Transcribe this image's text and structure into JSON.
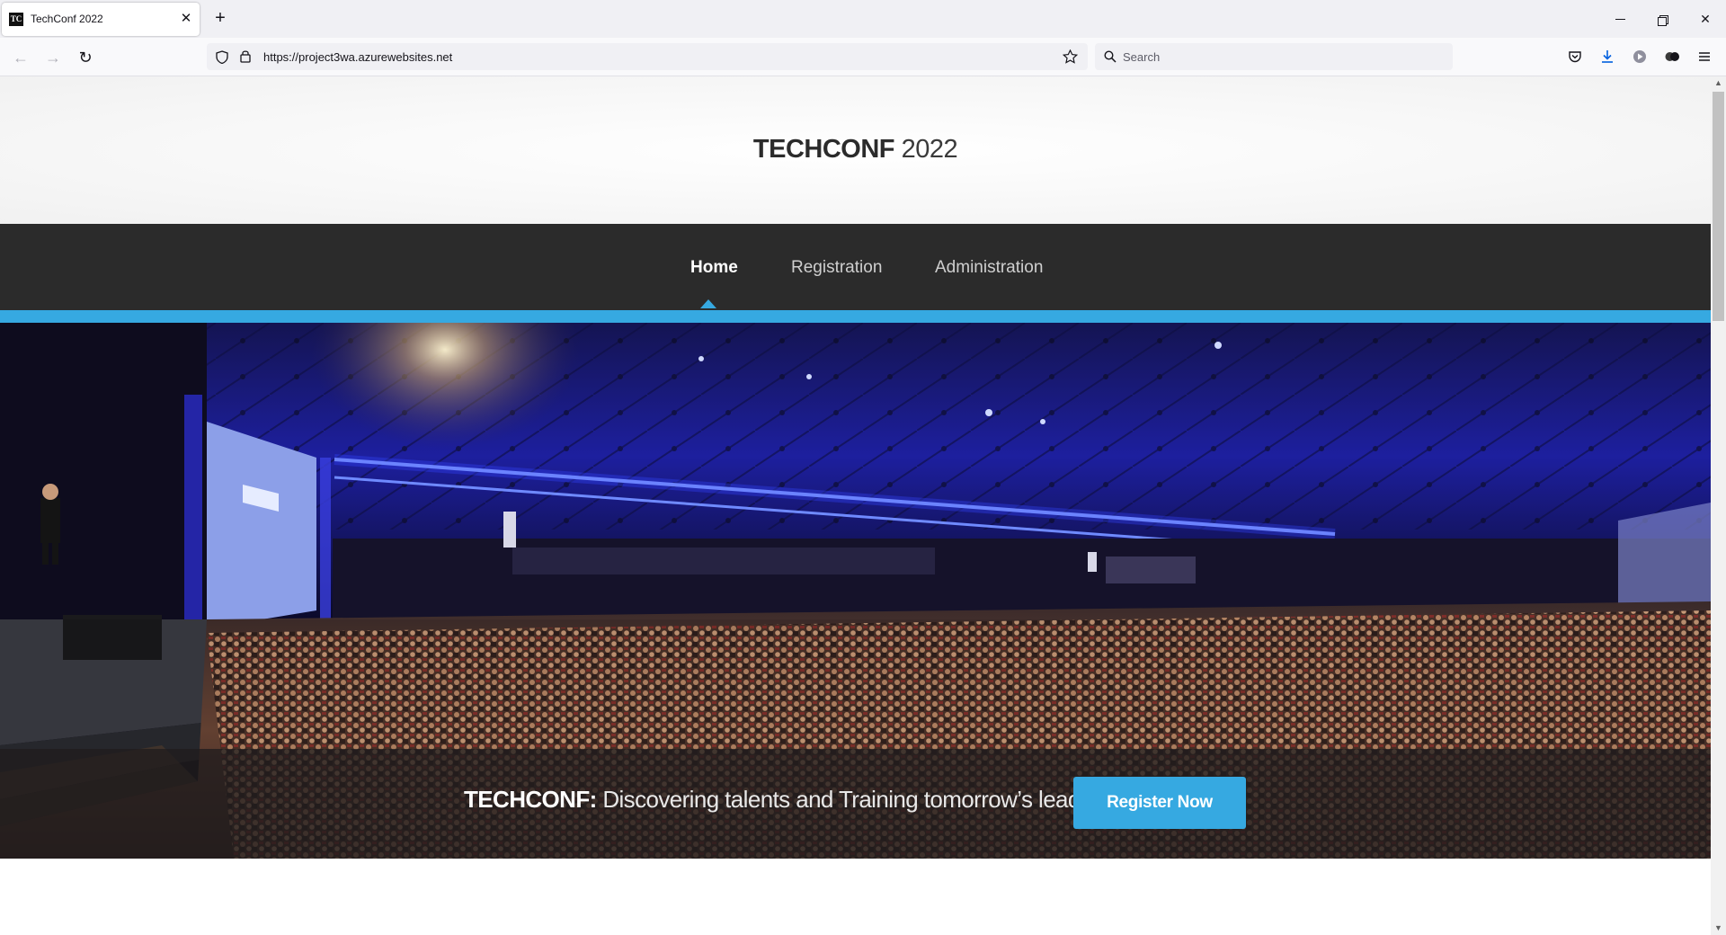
{
  "browser": {
    "tab_title": "TechConf 2022",
    "tab_favicon_text": "TC",
    "url": "https://project3wa.azurewebsites.net",
    "search_placeholder": "Search"
  },
  "site": {
    "brand": "TECHCONF",
    "year": "2022",
    "nav": [
      {
        "label": "Home",
        "active": true
      },
      {
        "label": "Registration",
        "active": false
      },
      {
        "label": "Administration",
        "active": false
      }
    ],
    "banner_brand": "TECHCONF:",
    "banner_tagline": "Discovering talents and Training tomorrow’s leaders",
    "register_label": "Register Now"
  },
  "colors": {
    "accent": "#36a9e1",
    "nav_background": "#2b2b2b"
  }
}
